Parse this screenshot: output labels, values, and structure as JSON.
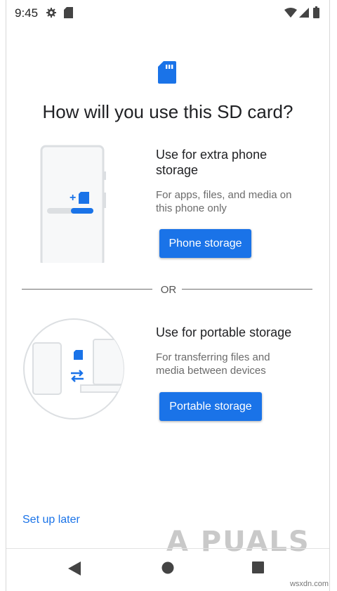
{
  "status_bar": {
    "time": "9:45",
    "icons": [
      "gear-icon",
      "sd-card-icon",
      "wifi-icon",
      "signal-icon",
      "battery-icon"
    ]
  },
  "page": {
    "title": "How will you use this SD card?",
    "hero_icon": "sd-card-icon"
  },
  "options": {
    "phone": {
      "title_line1": "Use for extra phone",
      "title_line2": "storage",
      "desc_line1": "For apps, files, and media on",
      "desc_line2": "this phone only",
      "button_label": "Phone storage"
    },
    "divider_label": "OR",
    "portable": {
      "title": "Use for portable storage",
      "desc_line1": "For transferring files and",
      "desc_line2": "media between devices",
      "button_label": "Portable storage"
    }
  },
  "footer": {
    "later_label": "Set up later"
  },
  "nav_bar": {
    "icons": [
      "back-icon",
      "home-icon",
      "recents-icon"
    ]
  },
  "watermark": {
    "text": "A  PUALS",
    "site": "wsxdn.com"
  },
  "colors": {
    "accent": "#1a73e8",
    "text_primary": "#202124",
    "text_secondary": "#6b6b6b"
  }
}
